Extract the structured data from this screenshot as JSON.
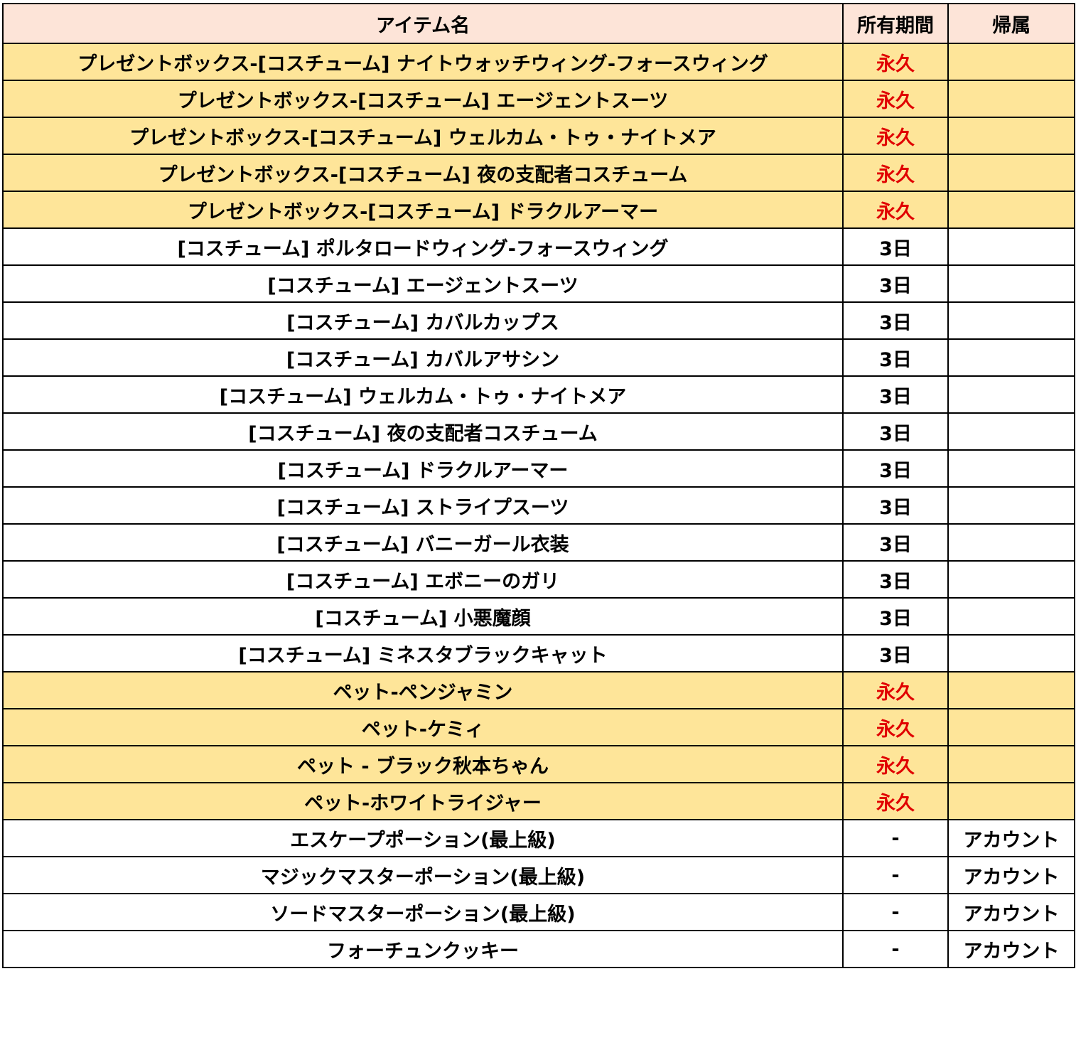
{
  "headers": {
    "name": "アイテム名",
    "period": "所有期間",
    "bind": "帰属"
  },
  "rows": [
    {
      "name": "プレゼントボックス-[コスチューム] ナイトウォッチウィング-フォースウィング",
      "period": "永久",
      "bind": "",
      "highlight": true
    },
    {
      "name": "プレゼントボックス-[コスチューム] エージェントスーツ",
      "period": "永久",
      "bind": "",
      "highlight": true
    },
    {
      "name": "プレゼントボックス-[コスチューム] ウェルカム・トゥ・ナイトメア",
      "period": "永久",
      "bind": "",
      "highlight": true
    },
    {
      "name": "プレゼントボックス-[コスチューム] 夜の支配者コスチューム",
      "period": "永久",
      "bind": "",
      "highlight": true
    },
    {
      "name": "プレゼントボックス-[コスチューム] ドラクルアーマー",
      "period": "永久",
      "bind": "",
      "highlight": true
    },
    {
      "name": "[コスチューム] ポルタロードウィング-フォースウィング",
      "period": "3日",
      "bind": "",
      "highlight": false
    },
    {
      "name": "[コスチューム] エージェントスーツ",
      "period": "3日",
      "bind": "",
      "highlight": false
    },
    {
      "name": "[コスチューム] カバルカップス",
      "period": "3日",
      "bind": "",
      "highlight": false
    },
    {
      "name": "[コスチューム] カバルアサシン",
      "period": "3日",
      "bind": "",
      "highlight": false
    },
    {
      "name": "[コスチューム] ウェルカム・トゥ・ナイトメア",
      "period": "3日",
      "bind": "",
      "highlight": false
    },
    {
      "name": "[コスチューム] 夜の支配者コスチューム",
      "period": "3日",
      "bind": "",
      "highlight": false
    },
    {
      "name": "[コスチューム] ドラクルアーマー",
      "period": "3日",
      "bind": "",
      "highlight": false
    },
    {
      "name": "[コスチューム] ストライプスーツ",
      "period": "3日",
      "bind": "",
      "highlight": false
    },
    {
      "name": "[コスチューム] バニーガール衣装",
      "period": "3日",
      "bind": "",
      "highlight": false
    },
    {
      "name": "[コスチューム] エボニーのガリ",
      "period": "3日",
      "bind": "",
      "highlight": false
    },
    {
      "name": "[コスチューム] 小悪魔顔",
      "period": "3日",
      "bind": "",
      "highlight": false
    },
    {
      "name": "[コスチューム] ミネスタブラックキャット",
      "period": "3日",
      "bind": "",
      "highlight": false
    },
    {
      "name": "ペット-ペンジャミン",
      "period": "永久",
      "bind": "",
      "highlight": true
    },
    {
      "name": "ペット-ケミィ",
      "period": "永久",
      "bind": "",
      "highlight": true
    },
    {
      "name": "ペット - ブラック秋本ちゃん",
      "period": "永久",
      "bind": "",
      "highlight": true
    },
    {
      "name": "ペット-ホワイトライジャー",
      "period": "永久",
      "bind": "",
      "highlight": true
    },
    {
      "name": "エスケープポーション(最上級)",
      "period": "-",
      "bind": "アカウント",
      "highlight": false
    },
    {
      "name": "マジックマスターポーション(最上級)",
      "period": "-",
      "bind": "アカウント",
      "highlight": false
    },
    {
      "name": "ソードマスターポーション(最上級)",
      "period": "-",
      "bind": "アカウント",
      "highlight": false
    },
    {
      "name": "フォーチュンクッキー",
      "period": "-",
      "bind": "アカウント",
      "highlight": false
    }
  ],
  "colors": {
    "header_bg": "#fde4d8",
    "highlight_bg": "#fee599",
    "plain_bg": "#ffffff",
    "permanent_text": "#e00000",
    "border": "#000000"
  }
}
